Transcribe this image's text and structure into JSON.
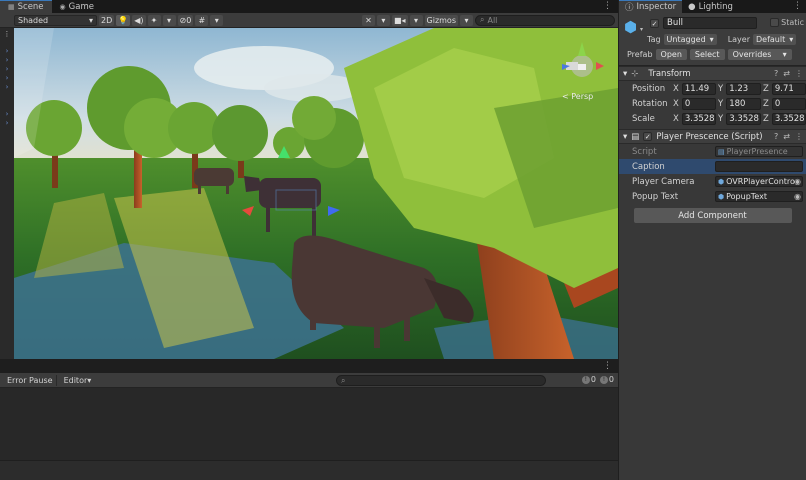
{
  "scene_panel": {
    "tabs": [
      {
        "label": "Scene",
        "icon": "grid-icon",
        "active": true
      },
      {
        "label": "Game",
        "icon": "gamepad-icon",
        "active": false
      }
    ],
    "toolbar": {
      "shading_mode": "Shaded",
      "mode_2d": "2D",
      "hidden_count": "0",
      "gizmos_label": "Gizmos",
      "search_placeholder": "All"
    },
    "orientation_label": "< Persp"
  },
  "console_panel": {
    "error_pause_label": "Error Pause",
    "editor_label": "Editor",
    "error_count": "0",
    "warning_count": "0"
  },
  "inspector": {
    "tabs": [
      {
        "label": "Inspector",
        "icon": "info-icon",
        "active": true
      },
      {
        "label": "Lighting",
        "icon": "bulb-icon",
        "active": false
      }
    ],
    "object_name": "Bull",
    "static_label": "Static",
    "tag_label": "Tag",
    "tag_value": "Untagged",
    "layer_label": "Layer",
    "layer_value": "Default",
    "prefab_label": "Prefab",
    "open_label": "Open",
    "select_label": "Select",
    "overrides_label": "Overrides",
    "transform": {
      "title": "Transform",
      "position": {
        "label": "Position",
        "x": "11.49",
        "y": "1.23",
        "z": "9.71"
      },
      "rotation": {
        "label": "Rotation",
        "x": "0",
        "y": "180",
        "z": "0"
      },
      "scale": {
        "label": "Scale",
        "x": "3.3528",
        "y": "3.3528",
        "z": "3.3528"
      }
    },
    "script_component": {
      "title": "Player Prescence (Script)",
      "script_label": "Script",
      "script_value": "PlayerPresence",
      "caption_label": "Caption",
      "player_camera_label": "Player Camera",
      "player_camera_value": "OVRPlayerContro",
      "popup_text_label": "Popup Text",
      "popup_text_value": "PopupText"
    },
    "add_component_label": "Add Component"
  },
  "axis_labels": {
    "x": "X",
    "y": "Y",
    "z": "Z"
  },
  "colors": {
    "accent_blue": "#3a79bb",
    "sky": "#9fc6de",
    "grass": "#2f7d2a",
    "water": "#3b6f8d"
  }
}
